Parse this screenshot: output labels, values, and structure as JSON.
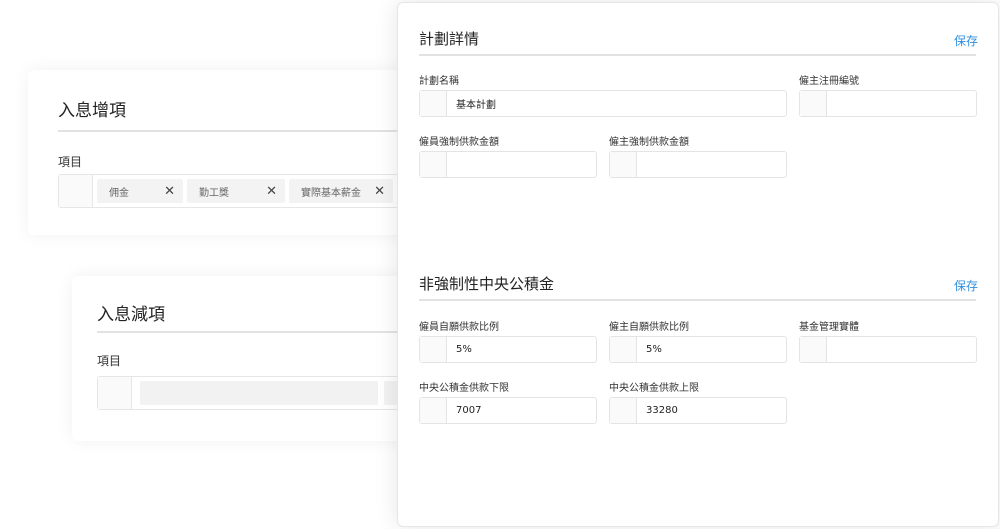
{
  "income_add": {
    "title": "入息增項",
    "items_label": "項目",
    "tags": [
      {
        "label": "佣金"
      },
      {
        "label": "勤工獎"
      },
      {
        "label": "實際基本薪金"
      }
    ]
  },
  "income_deduct": {
    "title": "入息減項",
    "items_label": "項目"
  },
  "plan_details": {
    "title": "計劃詳情",
    "save_label": "保存",
    "plan_name_label": "計劃名稱",
    "plan_name_value": "基本計劃",
    "employer_reg_label": "僱主注冊編號",
    "employer_reg_value": "",
    "employee_mandatory_label": "僱員強制供款金額",
    "employee_mandatory_value": "",
    "employer_mandatory_label": "僱主強制供款金額",
    "employer_mandatory_value": ""
  },
  "voluntary_mpf": {
    "title": "非強制性中央公積金",
    "save_label": "保存",
    "employee_ratio_label": "僱員自願供款比例",
    "employee_ratio_value": "5%",
    "employer_ratio_label": "僱主自願供款比例",
    "employer_ratio_value": "5%",
    "fund_entity_label": "基金管理實體",
    "fund_entity_value": "",
    "lower_limit_label": "中央公積金供款下限",
    "lower_limit_value": "7007",
    "upper_limit_label": "中央公積金供款上限",
    "upper_limit_value": "33280"
  },
  "colors": {
    "accent": "#2f8fe0",
    "rule": "#e2e2e2"
  }
}
